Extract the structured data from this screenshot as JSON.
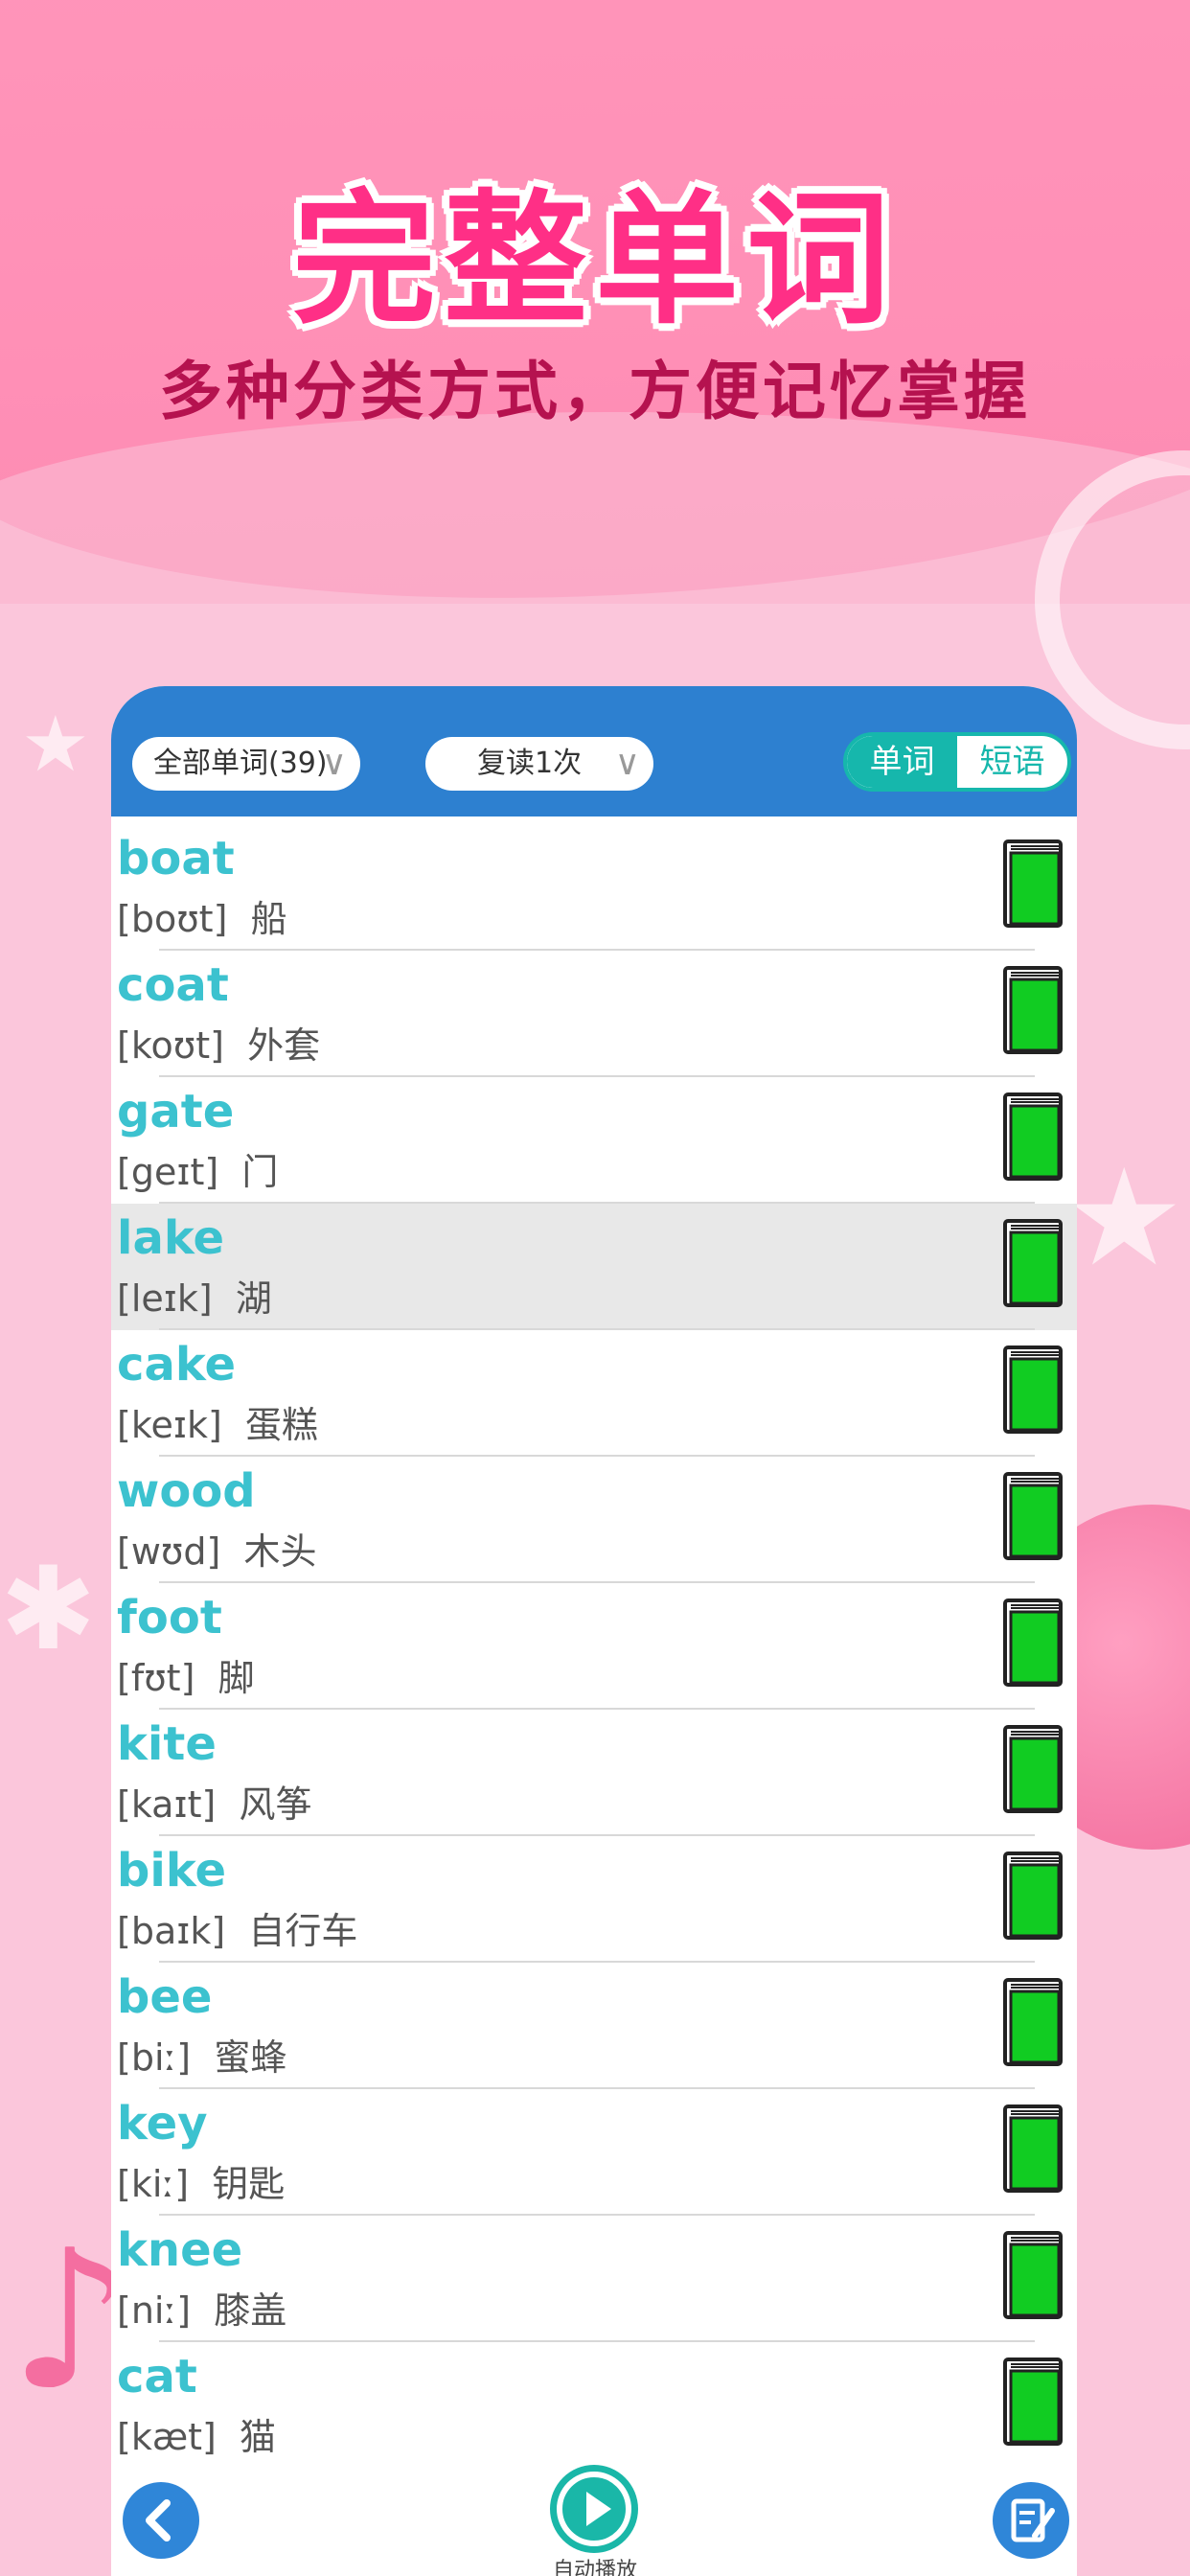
{
  "headline": "完整单词",
  "subline": "多种分类方式，方便记忆掌握",
  "toolbar": {
    "filter_label": "全部单词(39)",
    "repeat_label": "复读1次",
    "segment": {
      "active": "单词",
      "inactive": "短语"
    }
  },
  "words": [
    {
      "word": "boat",
      "phonetic": "[boʊt]",
      "meaning": "船"
    },
    {
      "word": "coat",
      "phonetic": "[koʊt]",
      "meaning": "外套"
    },
    {
      "word": "gate",
      "phonetic": "[geɪt]",
      "meaning": "门"
    },
    {
      "word": "lake",
      "phonetic": "[leɪk]",
      "meaning": "湖"
    },
    {
      "word": "cake",
      "phonetic": "[keɪk]",
      "meaning": "蛋糕"
    },
    {
      "word": "wood",
      "phonetic": "[wʊd]",
      "meaning": "木头"
    },
    {
      "word": "foot",
      "phonetic": "[fʊt]",
      "meaning": "脚"
    },
    {
      "word": "kite",
      "phonetic": "[kaɪt]",
      "meaning": "风筝"
    },
    {
      "word": "bike",
      "phonetic": "[baɪk]",
      "meaning": "自行车"
    },
    {
      "word": "bee",
      "phonetic": "[biː]",
      "meaning": "蜜蜂"
    },
    {
      "word": "key",
      "phonetic": "[kiː]",
      "meaning": "钥匙"
    },
    {
      "word": "knee",
      "phonetic": "[niː]",
      "meaning": "膝盖"
    },
    {
      "word": "cat",
      "phonetic": "[kæt]",
      "meaning": "猫"
    }
  ],
  "highlighted_word": "lake",
  "bottom": {
    "play_label": "自动播放"
  },
  "colors": {
    "accent": "#16b7ac",
    "toolbar": "#2d80d0",
    "word": "#3cc2cf",
    "headline": "#ff2f86"
  }
}
